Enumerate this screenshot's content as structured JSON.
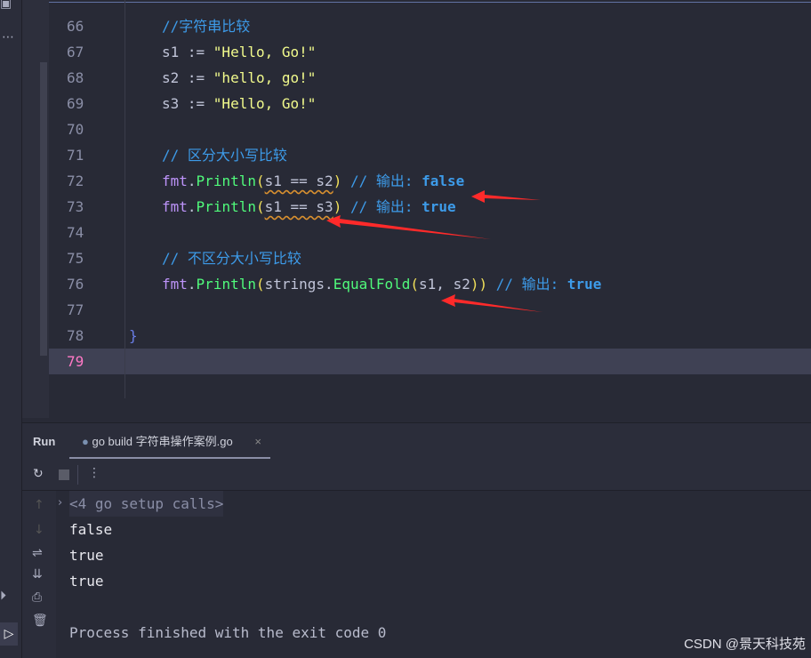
{
  "editor": {
    "lines": [
      {
        "n": "66",
        "parts": [
          [
            "cm",
            "//字符串比较"
          ]
        ]
      },
      {
        "n": "67",
        "parts": [
          [
            "var",
            "s1 := "
          ],
          [
            "str",
            "\"Hello, Go!\""
          ]
        ]
      },
      {
        "n": "68",
        "parts": [
          [
            "var",
            "s2 := "
          ],
          [
            "str",
            "\"hello, go!\""
          ]
        ]
      },
      {
        "n": "69",
        "parts": [
          [
            "var",
            "s3 := "
          ],
          [
            "str",
            "\"Hello, Go!\""
          ]
        ]
      },
      {
        "n": "70",
        "parts": []
      },
      {
        "n": "71",
        "parts": [
          [
            "cm",
            "// 区分大小写比较"
          ]
        ]
      },
      {
        "n": "72",
        "parts": [
          [
            "pk",
            "fmt"
          ],
          [
            "var",
            "."
          ],
          [
            "fn",
            "Println"
          ],
          [
            "par",
            "("
          ],
          [
            "var sq",
            "s1 == s2"
          ],
          [
            "par",
            ")"
          ],
          [
            "cm",
            " // 输出: "
          ],
          [
            "kw",
            "false"
          ]
        ]
      },
      {
        "n": "73",
        "parts": [
          [
            "pk",
            "fmt"
          ],
          [
            "var",
            "."
          ],
          [
            "fn",
            "Println"
          ],
          [
            "par",
            "("
          ],
          [
            "var sq",
            "s1 == s3"
          ],
          [
            "par",
            ")"
          ],
          [
            "cm",
            " // 输出: "
          ],
          [
            "kw",
            "true"
          ]
        ]
      },
      {
        "n": "74",
        "parts": []
      },
      {
        "n": "75",
        "parts": [
          [
            "cm",
            "// 不区分大小写比较"
          ]
        ]
      },
      {
        "n": "76",
        "parts": [
          [
            "pk",
            "fmt"
          ],
          [
            "var",
            "."
          ],
          [
            "fn",
            "Println"
          ],
          [
            "par",
            "("
          ],
          [
            "var",
            "strings."
          ],
          [
            "fn",
            "EqualFold"
          ],
          [
            "par",
            "("
          ],
          [
            "var",
            "s1, s2"
          ],
          [
            "par",
            "))"
          ],
          [
            "cm",
            " // 输出: "
          ],
          [
            "kw",
            "true"
          ]
        ]
      },
      {
        "n": "77",
        "parts": []
      },
      {
        "n": "78",
        "brace": "}",
        "parts": []
      },
      {
        "n": "79",
        "parts": [],
        "current": true
      }
    ]
  },
  "run": {
    "label": "Run",
    "tab_label": "go build 字符串操作案例.go",
    "close": "×"
  },
  "console": {
    "lines": [
      "<4 go setup calls>",
      "false",
      "true",
      "true",
      "",
      "Process finished with the exit code 0"
    ]
  },
  "watermark": "CSDN @景天科技苑",
  "colors": {
    "accent": "#ff2a2a"
  }
}
